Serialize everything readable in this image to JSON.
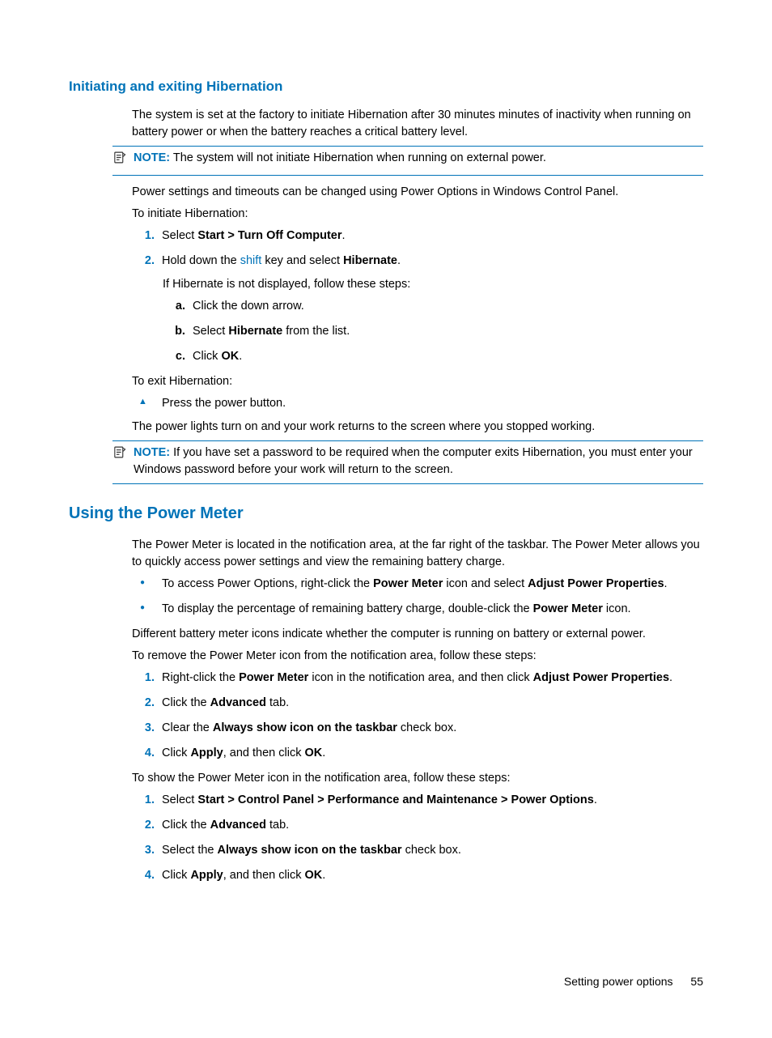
{
  "h2a": "Initiating and exiting Hibernation",
  "p1": "The system is set at the factory to initiate Hibernation after 30 minutes minutes of inactivity when running on battery power or when the battery reaches a critical battery level.",
  "note1_label": "NOTE:",
  "note1_body": "The system will not initiate Hibernation when running on external power.",
  "p2": "Power settings and timeouts can be changed using Power Options in Windows Control Panel.",
  "p3": "To initiate Hibernation:",
  "li1a": "Select ",
  "li1b": "Start > Turn Off Computer",
  "li1c": ".",
  "li2a": "Hold down the ",
  "li2b": "shift",
  "li2c": " key and select ",
  "li2d": "Hibernate",
  "li2e": ".",
  "p4": "If Hibernate is not displayed, follow these steps:",
  "sa": "Click the down arrow.",
  "sb_a": "Select ",
  "sb_b": "Hibernate",
  "sb_c": " from the list.",
  "sc_a": "Click ",
  "sc_b": "OK",
  "sc_c": ".",
  "p5": "To exit Hibernation:",
  "tri1": "Press the power button.",
  "p6": "The power lights turn on and your work returns to the screen where you stopped working.",
  "note2_label": "NOTE:",
  "note2_body": "If you have set a password to be required when the computer exits Hibernation, you must enter your Windows password before your work will return to the screen.",
  "h1": "Using the Power Meter",
  "p7": "The Power Meter is located in the notification area, at the far right of the taskbar. The Power Meter allows you to quickly access power settings and view the remaining battery charge.",
  "b1_a": "To access Power Options, right-click the ",
  "b1_b": "Power Meter",
  "b1_c": " icon and select ",
  "b1_d": "Adjust Power Properties",
  "b1_e": ".",
  "b2_a": "To display the percentage of remaining battery charge, double-click the ",
  "b2_b": "Power Meter",
  "b2_c": " icon.",
  "p8": "Different battery meter icons indicate whether the computer is running on battery or external power.",
  "p9": "To remove the Power Meter icon from the notification area, follow these steps:",
  "r1_a": "Right-click the ",
  "r1_b": "Power Meter",
  "r1_c": " icon in the notification area, and then click ",
  "r1_d": "Adjust Power Properties",
  "r1_e": ".",
  "r2_a": "Click the ",
  "r2_b": "Advanced",
  "r2_c": " tab.",
  "r3_a": "Clear the ",
  "r3_b": "Always show icon on the taskbar",
  "r3_c": " check box.",
  "r4_a": "Click ",
  "r4_b": "Apply",
  "r4_c": ", and then click ",
  "r4_d": "OK",
  "r4_e": ".",
  "p10": "To show the Power Meter icon in the notification area, follow these steps:",
  "s1_a": "Select ",
  "s1_b": "Start > Control Panel > Performance and Maintenance > Power Options",
  "s1_c": ".",
  "s2_a": "Click the ",
  "s2_b": "Advanced",
  "s2_c": " tab.",
  "s3_a": "Select the ",
  "s3_b": "Always show icon on the taskbar",
  "s3_c": " check box.",
  "s4_a": "Click ",
  "s4_b": "Apply",
  "s4_c": ", and then click ",
  "s4_d": "OK",
  "s4_e": ".",
  "footer_text": "Setting power options",
  "footer_page": "55"
}
